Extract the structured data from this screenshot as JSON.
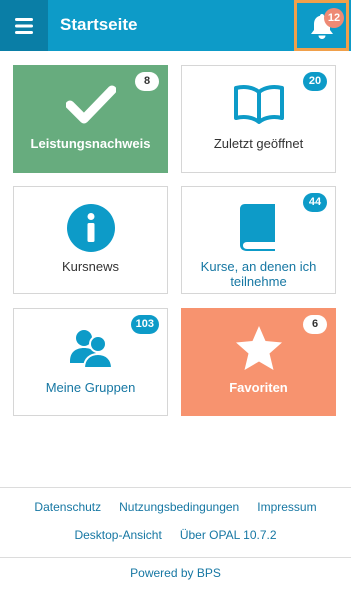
{
  "header": {
    "title": "Startseite",
    "notification_count": "12",
    "accent_color": "#0d9bc8",
    "highlight_color": "#f0a04b"
  },
  "tiles": [
    {
      "label": "Leistungsnachweis",
      "badge": "8",
      "icon": "checkmark-icon",
      "color": "#67ac7e"
    },
    {
      "label": "Zuletzt geöffnet",
      "badge": "20",
      "icon": "open-book-icon"
    },
    {
      "label": "Kursnews",
      "badge": "",
      "icon": "info-circle-icon"
    },
    {
      "label": "Kurse, an denen ich teilnehme",
      "badge": "44",
      "icon": "book-icon"
    },
    {
      "label": "Meine Gruppen",
      "badge": "103",
      "icon": "users-icon"
    },
    {
      "label": "Favoriten",
      "badge": "6",
      "icon": "star-icon",
      "color": "#f7936f"
    }
  ],
  "footer": {
    "links_row1": [
      "Datenschutz",
      "Nutzungsbedingungen",
      "Impressum"
    ],
    "links_row2": [
      "Desktop-Ansicht",
      "Über OPAL 10.7.2"
    ],
    "powered_by": "Powered by BPS"
  }
}
